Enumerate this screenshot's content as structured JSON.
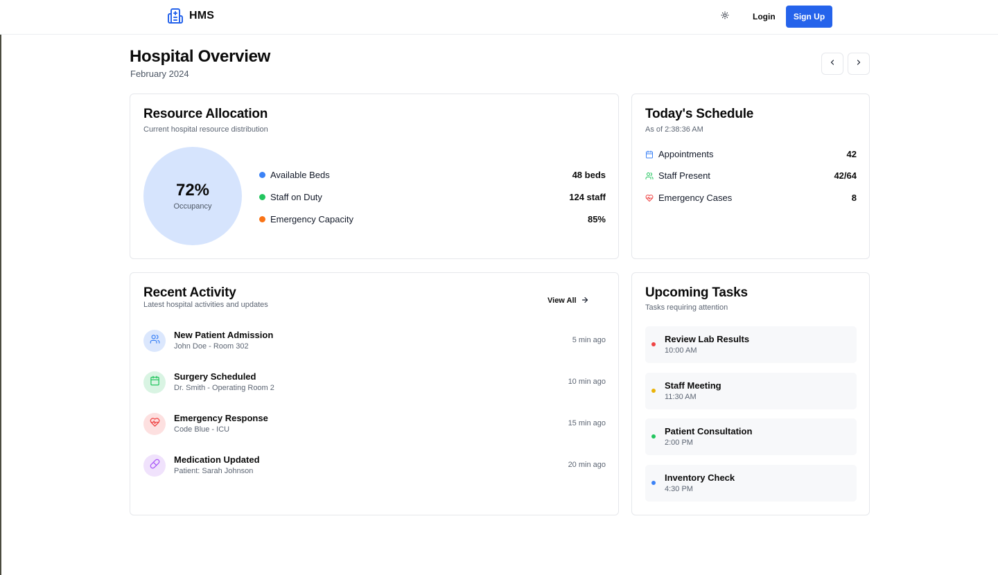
{
  "nav": {
    "brand": "HMS",
    "login_label": "Login",
    "signup_label": "Sign Up",
    "icons": {
      "brand": "hospital-icon",
      "theme": "sun-icon"
    },
    "accent": "#2563eb"
  },
  "header": {
    "title": "Hospital Overview",
    "subtitle": "February 2024",
    "prev_icon": "chevron-left-icon",
    "next_icon": "chevron-right-icon"
  },
  "resource": {
    "title": "Resource Allocation",
    "subtitle": "Current hospital resource distribution",
    "occupancy_value": "72%",
    "occupancy_label": "Occupancy",
    "items": [
      {
        "label": "Available Beds",
        "value": "48 beds",
        "color": "#3b82f6"
      },
      {
        "label": "Staff on Duty",
        "value": "124 staff",
        "color": "#22c55e"
      },
      {
        "label": "Emergency Capacity",
        "value": "85%",
        "color": "#f97316"
      }
    ]
  },
  "schedule": {
    "title": "Today's Schedule",
    "subtitle": "As of 2:38:36 AM",
    "items": [
      {
        "label": "Appointments",
        "value": "42",
        "icon": "calendar-icon",
        "color": "#3b82f6"
      },
      {
        "label": "Staff Present",
        "value": "42/64",
        "icon": "users-icon",
        "color": "#22c55e"
      },
      {
        "label": "Emergency Cases",
        "value": "8",
        "icon": "heart-pulse-icon",
        "color": "#ef4444"
      }
    ]
  },
  "activity": {
    "title": "Recent Activity",
    "subtitle": "Latest hospital activities and updates",
    "view_all_label": "View All",
    "items": [
      {
        "title": "New Patient Admission",
        "detail": "John Doe - Room 302",
        "time": "5 min ago",
        "icon": "users-icon",
        "color": "#3b82f6",
        "bg": "#dbe7fd"
      },
      {
        "title": "Surgery Scheduled",
        "detail": "Dr. Smith - Operating Room 2",
        "time": "10 min ago",
        "icon": "calendar-icon",
        "color": "#22c55e",
        "bg": "#d9f4e3"
      },
      {
        "title": "Emergency Response",
        "detail": "Code Blue - ICU",
        "time": "15 min ago",
        "icon": "heart-pulse-icon",
        "color": "#ef4444",
        "bg": "#fde0e0"
      },
      {
        "title": "Medication Updated",
        "detail": "Patient: Sarah Johnson",
        "time": "20 min ago",
        "icon": "pill-icon",
        "color": "#a855f7",
        "bg": "#f0e2fc"
      }
    ]
  },
  "tasks": {
    "title": "Upcoming Tasks",
    "subtitle": "Tasks requiring attention",
    "items": [
      {
        "title": "Review Lab Results",
        "time": "10:00 AM",
        "color": "#ef4444"
      },
      {
        "title": "Staff Meeting",
        "time": "11:30 AM",
        "color": "#eab308"
      },
      {
        "title": "Patient Consultation",
        "time": "2:00 PM",
        "color": "#22c55e"
      },
      {
        "title": "Inventory Check",
        "time": "4:30 PM",
        "color": "#3b82f6"
      }
    ]
  }
}
